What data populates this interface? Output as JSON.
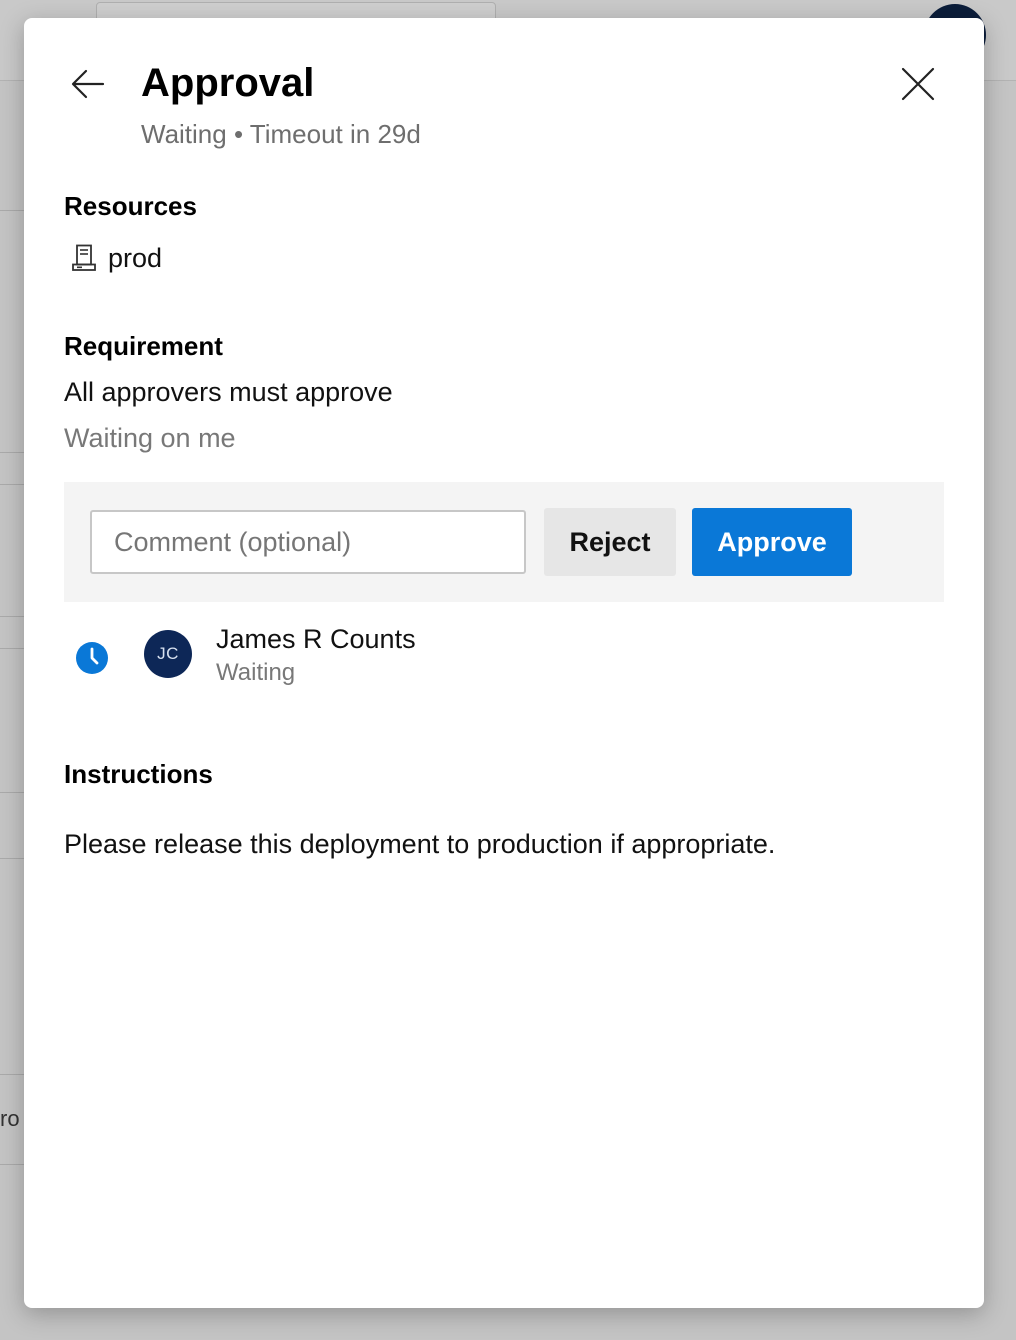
{
  "background": {
    "partial_text": "ro"
  },
  "dialog": {
    "title": "Approval",
    "subtitle": "Waiting • Timeout in 29d",
    "back_icon": "arrow-left-icon",
    "close_icon": "close-icon"
  },
  "resources": {
    "heading": "Resources",
    "items": [
      {
        "icon": "server-icon",
        "name": "prod"
      }
    ]
  },
  "requirement": {
    "heading": "Requirement",
    "rule": "All approvers must approve",
    "status": "Waiting on me"
  },
  "actions": {
    "comment_placeholder": "Comment (optional)",
    "comment_value": "",
    "reject_label": "Reject",
    "approve_label": "Approve"
  },
  "approvers": [
    {
      "status_icon": "clock-icon",
      "initials": "JC",
      "name": "James R Counts",
      "status": "Waiting"
    }
  ],
  "instructions": {
    "heading": "Instructions",
    "text": "Please release this deployment to production if appropriate."
  },
  "colors": {
    "accent": "#0a78d7",
    "avatar_bg": "#0d2757",
    "muted_text": "#787878",
    "panel_bg": "#f4f4f4"
  }
}
